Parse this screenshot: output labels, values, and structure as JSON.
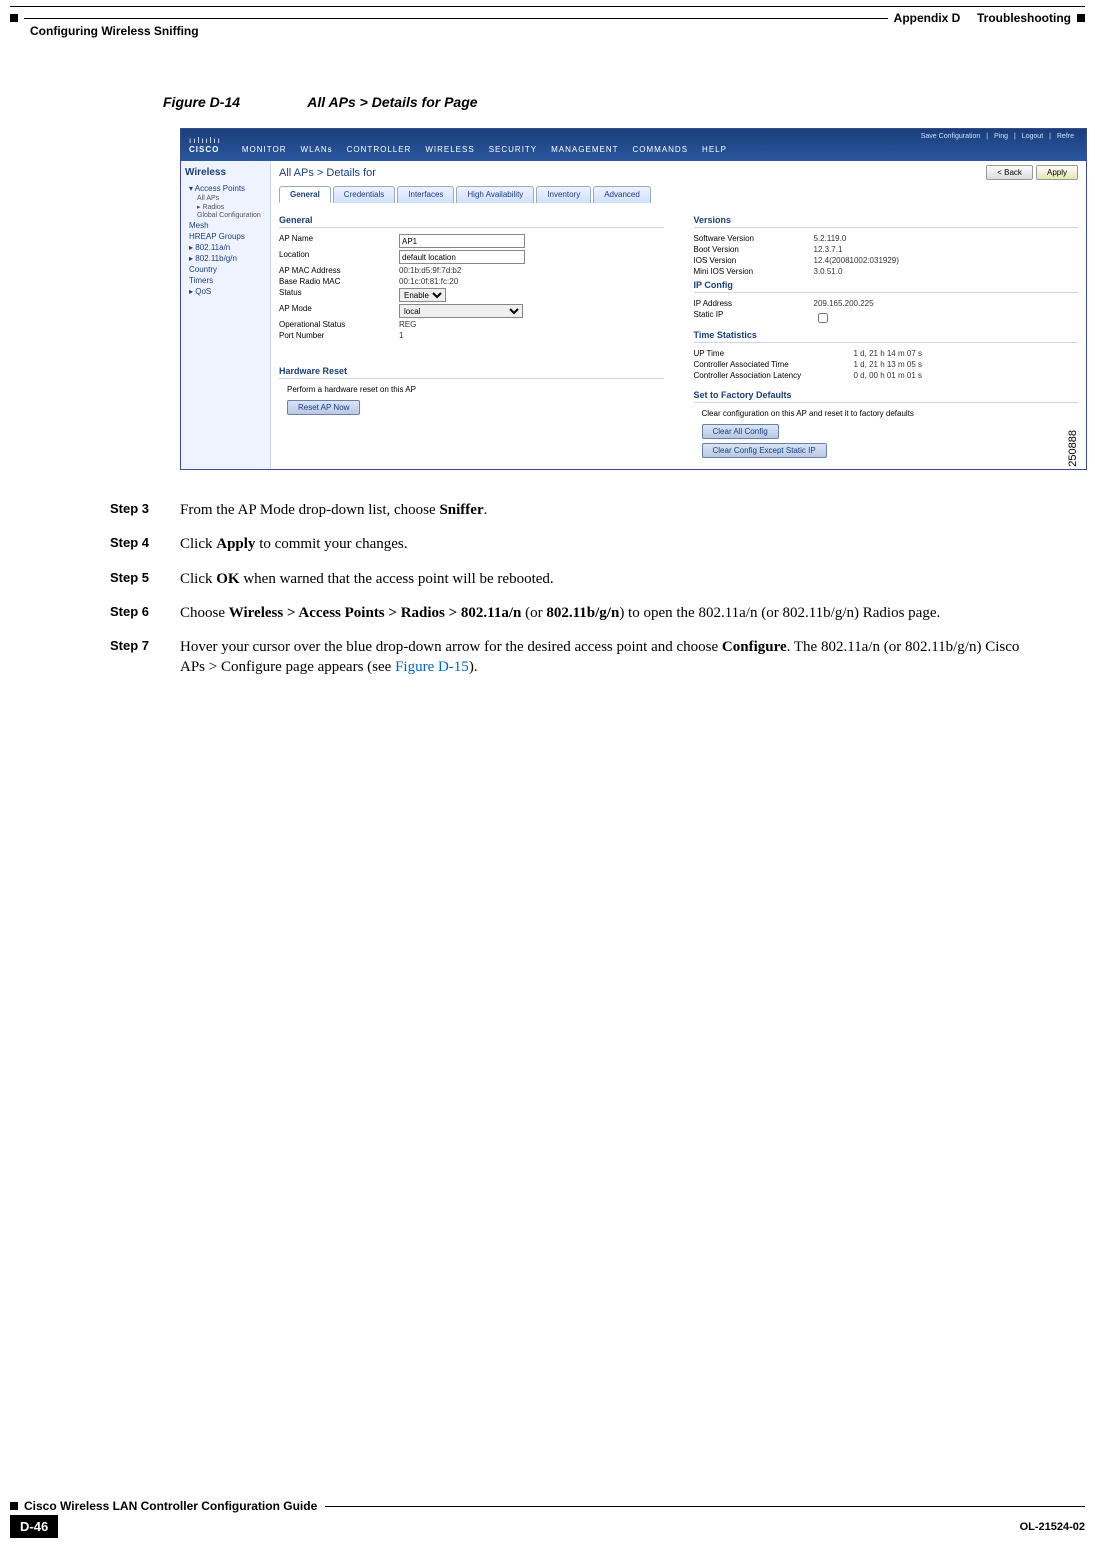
{
  "header": {
    "appendix": "Appendix D",
    "chapter": "Troubleshooting",
    "section": "Configuring Wireless Sniffing"
  },
  "figure": {
    "label": "Figure D-14",
    "title": "All APs > Details for Page",
    "image_no": "250888"
  },
  "screenshot": {
    "brand_glyph": "ıılıılıı",
    "brand": "CISCO",
    "top_links": {
      "save": "Save Configuration",
      "ping": "Ping",
      "logout": "Logout",
      "refresh": "Refre"
    },
    "nav": [
      "MONITOR",
      "WLANs",
      "CONTROLLER",
      "WIRELESS",
      "SECURITY",
      "MANAGEMENT",
      "COMMANDS",
      "HELP"
    ],
    "side_title": "Wireless",
    "side": {
      "access_points": "Access Points",
      "all_aps": "All APs",
      "radios": "Radios",
      "global_conf": "Global Configuration",
      "mesh": "Mesh",
      "hreap": "HREAP Groups",
      "r_an": "802.11a/n",
      "r_bgn": "802.11b/g/n",
      "country": "Country",
      "timers": "Timers",
      "qos": "QoS"
    },
    "crumb": "All APs > Details for",
    "btn_back": "< Back",
    "btn_apply": "Apply",
    "tabs": [
      "General",
      "Credentials",
      "Interfaces",
      "High Availability",
      "Inventory",
      "Advanced"
    ],
    "general": {
      "title": "General",
      "rows": {
        "ap_name_k": "AP Name",
        "ap_name_v": "AP1",
        "location_k": "Location",
        "location_v": "default location",
        "mac_k": "AP MAC Address",
        "mac_v": "00:1b:d5:9f:7d:b2",
        "base_k": "Base Radio MAC",
        "base_v": "00:1c:0f:81:fc:20",
        "status_k": "Status",
        "status_v": "Enable",
        "mode_k": "AP Mode",
        "mode_v": "local",
        "oper_k": "Operational Status",
        "oper_v": "REG",
        "port_k": "Port Number",
        "port_v": "1"
      }
    },
    "versions": {
      "title": "Versions",
      "rows": {
        "sw_k": "Software Version",
        "sw_v": "5.2.119.0",
        "boot_k": "Boot Version",
        "boot_v": "12.3.7.1",
        "ios_k": "IOS Version",
        "ios_v": "12.4(20081002:031929)",
        "mini_k": "Mini IOS Version",
        "mini_v": "3.0.51.0"
      }
    },
    "ipconfig": {
      "title": "IP Config",
      "rows": {
        "ip_k": "IP Address",
        "ip_v": "209.165.200.225",
        "static_k": "Static IP"
      }
    },
    "timestats": {
      "title": "Time Statistics",
      "rows": {
        "up_k": "UP Time",
        "up_v": "1 d, 21 h 14 m 07 s",
        "assoc_k": "Controller Associated Time",
        "assoc_v": "1 d, 21 h 13 m 05 s",
        "lat_k": "Controller Association Latency",
        "lat_v": "0 d, 00 h 01 m 01 s"
      }
    },
    "hwreset": {
      "title": "Hardware Reset",
      "text": "Perform a hardware reset on this AP",
      "btn": "Reset AP Now"
    },
    "factory": {
      "title": "Set to Factory Defaults",
      "text": "Clear configuration on this AP and reset it to factory defaults",
      "btn1": "Clear All Config",
      "btn2": "Clear Config Except Static IP"
    }
  },
  "steps": {
    "s3": {
      "num": "Step 3",
      "a": "From the AP Mode drop-down list, choose ",
      "b": "Sniffer",
      "c": "."
    },
    "s4": {
      "num": "Step 4",
      "a": "Click ",
      "b": "Apply",
      "c": " to commit your changes."
    },
    "s5": {
      "num": "Step 5",
      "a": "Click ",
      "b": "OK",
      "c": " when warned that the access point will be rebooted."
    },
    "s6": {
      "num": "Step 6",
      "a": "Choose ",
      "b": "Wireless > Access Points > Radios > 802.11a/n",
      "c": " (or ",
      "d": "802.11b/g/n",
      "e": ") to open the 802.11a/n (or 802.11b/g/n) Radios page."
    },
    "s7": {
      "num": "Step 7",
      "a": "Hover your cursor over the blue drop-down arrow for the desired access point and choose ",
      "b": "Configure",
      "c": ". The 802.11a/n (or 802.11b/g/n) Cisco APs > Configure page appears (see ",
      "link": "Figure D-15",
      "d": ")."
    }
  },
  "footer": {
    "title": "Cisco Wireless LAN Controller Configuration Guide",
    "page": "D-46",
    "doc": "OL-21524-02"
  }
}
